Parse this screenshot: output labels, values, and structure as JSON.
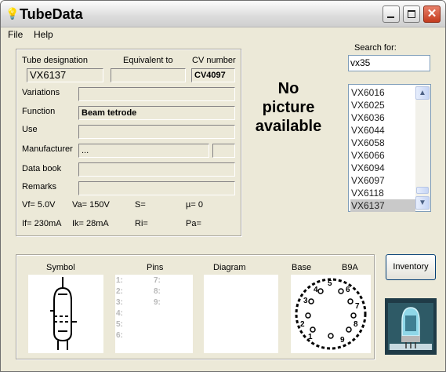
{
  "window": {
    "title": "TubeData"
  },
  "menu": {
    "file": "File",
    "help": "Help"
  },
  "details": {
    "tube_designation_label": "Tube designation",
    "equivalent_label": "Equivalent to",
    "cv_label": "CV number",
    "tube_designation": "VX6137",
    "equivalent": "",
    "cv_number": "CV4097",
    "variations_label": "Variations",
    "variations": "",
    "function_label": "Function",
    "function": "Beam tetrode",
    "use_label": "Use",
    "use": "",
    "manufacturer_label": "Manufacturer",
    "manufacturer": "...",
    "manufacturer_code": "",
    "databook_label": "Data book",
    "databook": "",
    "remarks_label": "Remarks",
    "remarks": "",
    "vf": "Vf= 5.0V",
    "va": "Va= 150V",
    "s": "S=",
    "mu": "µ=   0",
    "if": "If= 230mA",
    "ik": "Ik=  28mA",
    "ri": "Ri=",
    "pa": "Pa="
  },
  "picture": {
    "line1": "No",
    "line2": "picture",
    "line3": "available"
  },
  "search": {
    "label": "Search for:",
    "value": "vx35",
    "results": [
      "VX6016",
      "VX6025",
      "VX6036",
      "VX6044",
      "VX6058",
      "VX6066",
      "VX6094",
      "VX6097",
      "VX6118",
      "VX6137"
    ],
    "selected": "VX6137"
  },
  "bottom": {
    "symbol_label": "Symbol",
    "pins_label": "Pins",
    "diagram_label": "Diagram",
    "base_label": "Base",
    "base_type": "B9A",
    "pins": [
      "1:",
      "2:",
      "3:",
      "4:",
      "5:",
      "6:",
      "7:",
      "8:",
      "9:"
    ]
  },
  "buttons": {
    "inventory": "Inventory"
  }
}
